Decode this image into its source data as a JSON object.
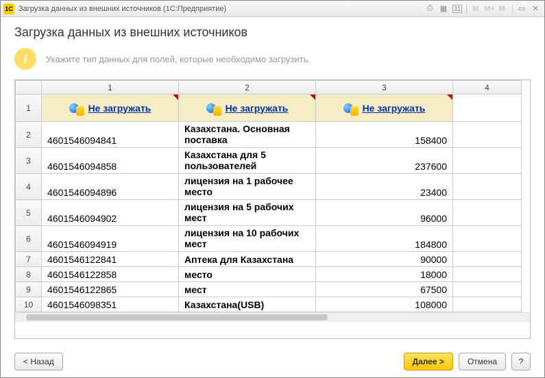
{
  "titlebar": {
    "app_badge": "1C",
    "text": "Загрузка данных из внешних источников  (1С:Предприятие)"
  },
  "page": {
    "title": "Загрузка данных из внешних источников",
    "hint": "Укажите тип данных для полей, которые необходимо загрузить."
  },
  "columns": [
    "1",
    "2",
    "3",
    "4"
  ],
  "header_link": "Не загружать",
  "rows": [
    {
      "n": "1",
      "c1": "",
      "c2": "",
      "c3": "",
      "header": true
    },
    {
      "n": "2",
      "c1": "4601546094841",
      "c2": "Казахстана. Основная поставка",
      "c3": "158400"
    },
    {
      "n": "3",
      "c1": "4601546094858",
      "c2": "Казахстана для 5 пользователей",
      "c3": "237600"
    },
    {
      "n": "4",
      "c1": "4601546094896",
      "c2": "лицензия на 1 рабочее место",
      "c3": "23400"
    },
    {
      "n": "5",
      "c1": "4601546094902",
      "c2": "лицензия на 5 рабочих мест",
      "c3": "96000"
    },
    {
      "n": "6",
      "c1": "4601546094919",
      "c2": "лицензия на 10 рабочих мест",
      "c3": "184800"
    },
    {
      "n": "7",
      "c1": "4601546122841",
      "c2": "Аптека для Казахстана",
      "c3": "90000"
    },
    {
      "n": "8",
      "c1": "4601546122858",
      "c2": "место",
      "c3": "18000"
    },
    {
      "n": "9",
      "c1": "4601546122865",
      "c2": "мест",
      "c3": "67500"
    },
    {
      "n": "10",
      "c1": "4601546098351",
      "c2": "Казахстана(USB)",
      "c3": "108000"
    }
  ],
  "footer": {
    "back": "< Назад",
    "next": "Далее >",
    "cancel": "Отмена",
    "help": "?"
  }
}
